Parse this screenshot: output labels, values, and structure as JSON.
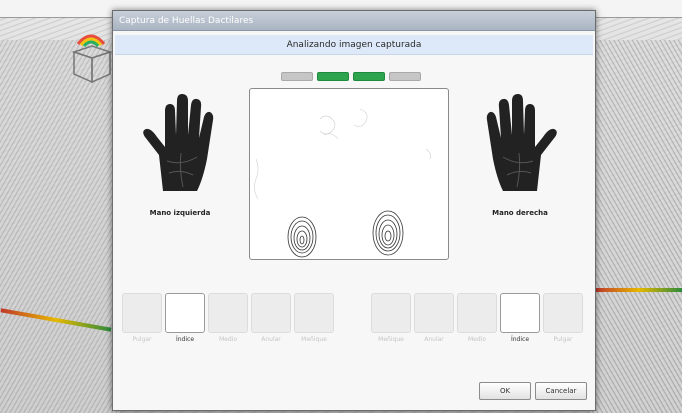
{
  "dialog": {
    "title": "Captura de Huellas Dactilares",
    "status": "Analizando imagen capturada",
    "progress": {
      "total": 4,
      "active": [
        2,
        3
      ]
    },
    "hands": {
      "left_label": "Mano izquierda",
      "right_label": "Mano derecha"
    },
    "left_fingers": [
      {
        "label": "Pulgar",
        "active": false
      },
      {
        "label": "Índice",
        "active": true
      },
      {
        "label": "Medio",
        "active": false
      },
      {
        "label": "Anular",
        "active": false
      },
      {
        "label": "Meñique",
        "active": false
      }
    ],
    "right_fingers": [
      {
        "label": "Meñique",
        "active": false
      },
      {
        "label": "Anular",
        "active": false
      },
      {
        "label": "Medio",
        "active": false
      },
      {
        "label": "Índice",
        "active": true
      },
      {
        "label": "Pulgar",
        "active": false
      }
    ],
    "buttons": {
      "ok": "OK",
      "cancel": "Cancelar"
    }
  },
  "colors": {
    "progress_active": "#2ea44f",
    "progress_inactive": "#c6c6c6",
    "status_bar": "#dde9f8"
  }
}
